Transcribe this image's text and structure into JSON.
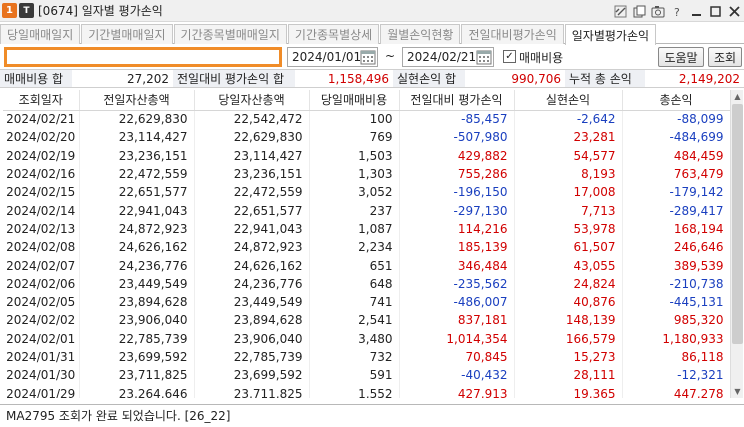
{
  "window": {
    "badge": "1",
    "badge2": "T",
    "title": "[0674] 일자별 평가손익"
  },
  "tabs": [
    {
      "label": "당일매매일지",
      "active": false
    },
    {
      "label": "기간별매매일지",
      "active": false
    },
    {
      "label": "기간종목별매매일지",
      "active": false
    },
    {
      "label": "기간종목별상세",
      "active": false
    },
    {
      "label": "월별손익현황",
      "active": false
    },
    {
      "label": "전일대비평가손익",
      "active": false
    },
    {
      "label": "일자별평가손익",
      "active": true
    }
  ],
  "controls": {
    "account_value": "",
    "start_date": "2024/01/01",
    "end_date": "2024/02/21",
    "tilde": "~",
    "include_fee_checked": true,
    "include_fee_mark": "✓",
    "include_fee_label": "매매비용",
    "help_label": "도움말",
    "query_label": "조회"
  },
  "summary": {
    "fee_total_label": "매매비용 합",
    "fee_total": "27,202",
    "prev_eval_label": "전일대비 평가손익 합",
    "prev_eval": "1,158,496",
    "realized_label": "실현손익 합",
    "realized": "990,706",
    "cum_label": "누적 총 손익",
    "cum": "2,149,202"
  },
  "table": {
    "headers": [
      "조회일자",
      "전일자산총액",
      "당일자산총액",
      "당일매매비용",
      "전일대비 평가손익",
      "실현손익",
      "총손익"
    ],
    "rows": [
      [
        "2024/02/21",
        "22,629,830",
        "22,542,472",
        "100",
        "-85,457",
        "-2,642",
        "-88,099"
      ],
      [
        "2024/02/20",
        "23,114,427",
        "22,629,830",
        "769",
        "-507,980",
        "23,281",
        "-484,699"
      ],
      [
        "2024/02/19",
        "23,236,151",
        "23,114,427",
        "1,503",
        "429,882",
        "54,577",
        "484,459"
      ],
      [
        "2024/02/16",
        "22,472,559",
        "23,236,151",
        "1,303",
        "755,286",
        "8,193",
        "763,479"
      ],
      [
        "2024/02/15",
        "22,651,577",
        "22,472,559",
        "3,052",
        "-196,150",
        "17,008",
        "-179,142"
      ],
      [
        "2024/02/14",
        "22,941,043",
        "22,651,577",
        "237",
        "-297,130",
        "7,713",
        "-289,417"
      ],
      [
        "2024/02/13",
        "24,872,923",
        "22,941,043",
        "1,087",
        "114,216",
        "53,978",
        "168,194"
      ],
      [
        "2024/02/08",
        "24,626,162",
        "24,872,923",
        "2,234",
        "185,139",
        "61,507",
        "246,646"
      ],
      [
        "2024/02/07",
        "24,236,776",
        "24,626,162",
        "651",
        "346,484",
        "43,055",
        "389,539"
      ],
      [
        "2024/02/06",
        "23,449,549",
        "24,236,776",
        "648",
        "-235,562",
        "24,824",
        "-210,738"
      ],
      [
        "2024/02/05",
        "23,894,628",
        "23,449,549",
        "741",
        "-486,007",
        "40,876",
        "-445,131"
      ],
      [
        "2024/02/02",
        "23,906,040",
        "23,894,628",
        "2,541",
        "837,181",
        "148,139",
        "985,320"
      ],
      [
        "2024/02/01",
        "22,785,739",
        "23,906,040",
        "3,480",
        "1,014,354",
        "166,579",
        "1,180,933"
      ],
      [
        "2024/01/31",
        "23,699,592",
        "22,785,739",
        "732",
        "70,845",
        "15,273",
        "86,118"
      ],
      [
        "2024/01/30",
        "23,711,825",
        "23,699,592",
        "591",
        "-40,432",
        "28,111",
        "-12,321"
      ],
      [
        "2024/01/29",
        "23,264,646",
        "23,711,825",
        "1,552",
        "427,913",
        "19,365",
        "447,278"
      ]
    ]
  },
  "status": {
    "message": "MA2795 조회가 완료 되었습니다. [26_22]"
  },
  "colors": {
    "positive": "#d10000",
    "negative": "#1a3fbf",
    "accent": "#f08c28"
  }
}
